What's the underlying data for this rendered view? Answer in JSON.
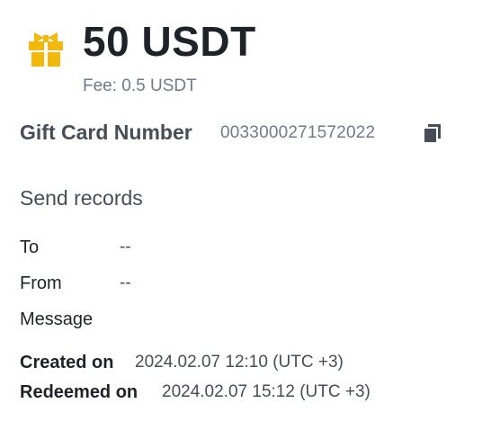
{
  "card": {
    "amount": "50 USDT",
    "fee": "Fee: 0.5 USDT",
    "number_label": "Gift Card Number",
    "number_value": "0033000271572022"
  },
  "records": {
    "title": "Send records",
    "to_label": "To",
    "to_value": "--",
    "from_label": "From",
    "from_value": "--",
    "message_label": "Message",
    "created_label": "Created on",
    "created_value": "2024.02.07 12:10 (UTC +3)",
    "redeemed_label": "Redeemed on",
    "redeemed_value": "2024.02.07 15:12 (UTC +3)"
  },
  "colors": {
    "gift_icon": "#f0b90b",
    "copy_icon": "#474d57",
    "text_primary": "#1e2329",
    "text_secondary": "#707a8a"
  },
  "icons": {
    "gift": "gift-icon",
    "copy": "copy-icon"
  }
}
